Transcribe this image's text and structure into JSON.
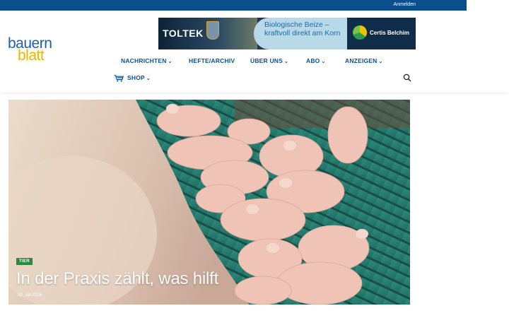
{
  "topbar": {
    "login_label": "Anmelden"
  },
  "logo": {
    "line1": "bauern",
    "line2": "blatt"
  },
  "banner": {
    "brand": "TOLTEK",
    "tagline": "Biologische Beize – kraftvoll direkt am Korn",
    "partner": "Certis Belchim"
  },
  "nav": {
    "items": [
      {
        "label": "NACHRICHTEN",
        "has_dropdown": true
      },
      {
        "label": "HEFTE/ARCHIV",
        "has_dropdown": false
      },
      {
        "label": "ÜBER UNS",
        "has_dropdown": true
      },
      {
        "label": "ABO",
        "has_dropdown": true
      },
      {
        "label": "ANZEIGEN",
        "has_dropdown": true
      },
      {
        "label": "SHOP",
        "has_dropdown": true
      }
    ],
    "chevron": "⌄",
    "search_icon": "search-icon",
    "cart_icon": "cart-icon"
  },
  "hero": {
    "category": "TIER",
    "title": "In der Praxis zählt, was hilft",
    "date": "30. Juli 2026"
  },
  "colors": {
    "topbar": "#0b4f8f",
    "nav_text": "#0b4f8f",
    "badge": "#2e8a41",
    "logo_blue": "#1c5fa8",
    "logo_yellow": "#f0b400"
  }
}
